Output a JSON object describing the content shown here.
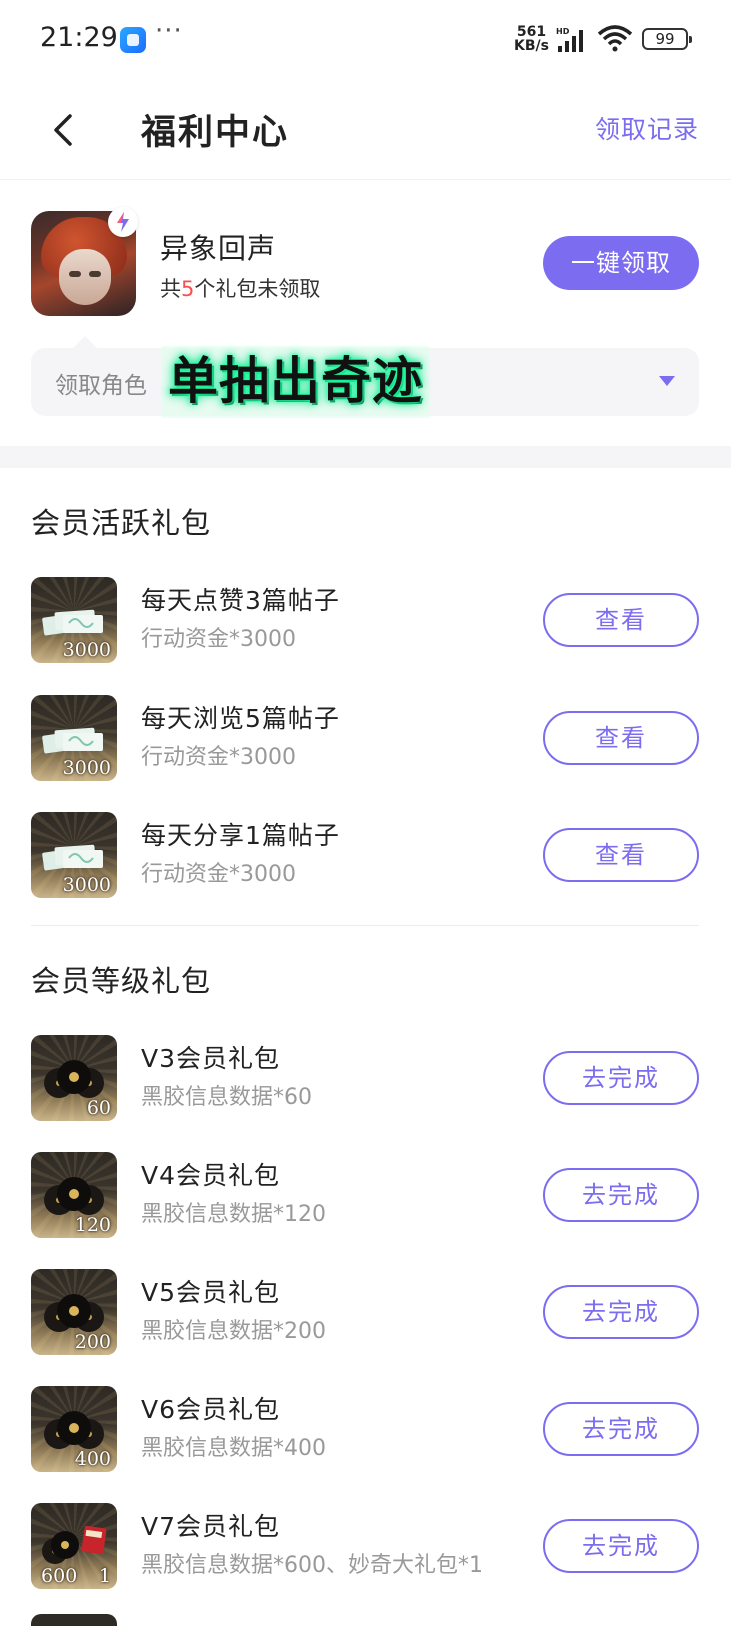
{
  "status": {
    "time": "21:29",
    "more": "···",
    "net_speed_top": "561",
    "net_speed_bottom": "KB/s",
    "battery": "99"
  },
  "header": {
    "title": "福利中心",
    "record_link": "领取记录"
  },
  "game": {
    "name": "异象回声",
    "sub_prefix": "共",
    "unclaimed_count": "5",
    "sub_suffix": "个礼包未领取",
    "claim_all": "一键领取",
    "role_label": "领取角色",
    "role_value": "单抽出奇迹"
  },
  "active_section": {
    "title": "会员活跃礼包",
    "items": [
      {
        "title": "每天点赞3篇帖子",
        "reward": "行动资金*3000",
        "thumb_num": "3000",
        "button": "查看"
      },
      {
        "title": "每天浏览5篇帖子",
        "reward": "行动资金*3000",
        "thumb_num": "3000",
        "button": "查看"
      },
      {
        "title": "每天分享1篇帖子",
        "reward": "行动资金*3000",
        "thumb_num": "3000",
        "button": "查看"
      }
    ]
  },
  "level_section": {
    "title": "会员等级礼包",
    "items": [
      {
        "title": "V3会员礼包",
        "reward": "黑胶信息数据*60",
        "thumb_num": "60",
        "button": "去完成"
      },
      {
        "title": "V4会员礼包",
        "reward": "黑胶信息数据*120",
        "thumb_num": "120",
        "button": "去完成"
      },
      {
        "title": "V5会员礼包",
        "reward": "黑胶信息数据*200",
        "thumb_num": "200",
        "button": "去完成"
      },
      {
        "title": "V6会员礼包",
        "reward": "黑胶信息数据*400",
        "thumb_num": "400",
        "button": "去完成"
      },
      {
        "title": "V7会员礼包",
        "reward": "黑胶信息数据*600、妙奇大礼包*1",
        "thumb_num": "600",
        "thumb_num2": "1",
        "button": "去完成"
      }
    ]
  },
  "colors": {
    "accent": "#7b6cf0",
    "highlight_count": "#ff4d4f",
    "muted_text": "#999999"
  }
}
